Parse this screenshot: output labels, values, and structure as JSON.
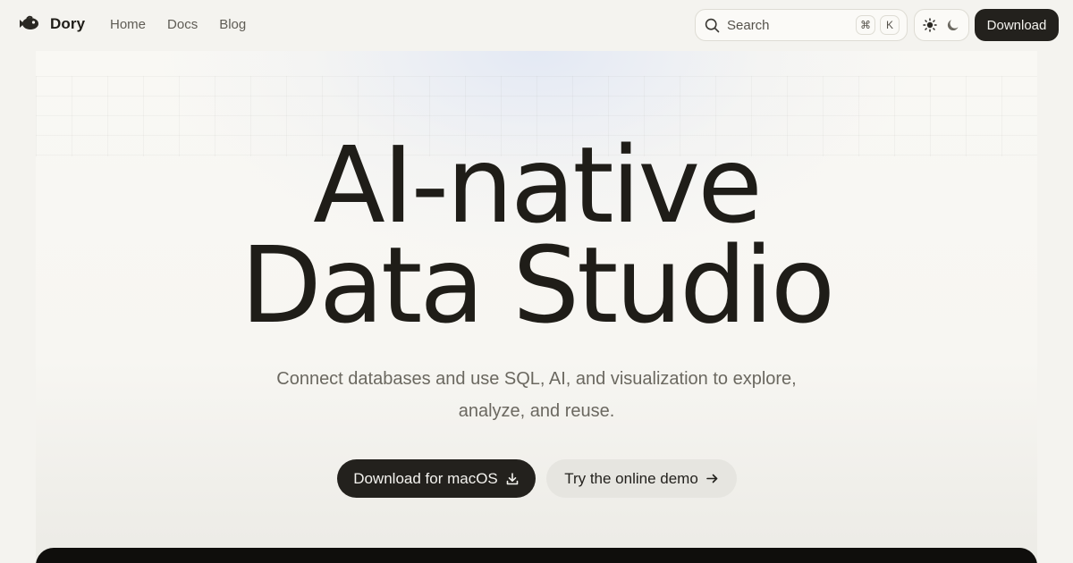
{
  "header": {
    "brand_name": "Dory",
    "nav": [
      {
        "label": "Home"
      },
      {
        "label": "Docs"
      },
      {
        "label": "Blog"
      }
    ],
    "search": {
      "placeholder": "Search",
      "shortcut_keys": [
        "⌘",
        "K"
      ]
    },
    "theme_toggle": {
      "light_icon": "sun-icon",
      "dark_icon": "moon-icon"
    },
    "download_label": "Download"
  },
  "hero": {
    "title_line1": "AI-native",
    "title_line2": "Data Studio",
    "subtitle": "Connect databases and use SQL, AI, and visualization to explore, analyze, and reuse.",
    "primary_cta": "Download for macOS",
    "secondary_cta": "Try the online demo"
  },
  "colors": {
    "background": "#f4f3ef",
    "dark": "#23211d",
    "text_muted": "#6b6860",
    "accent_glow": "#e2e8f4"
  }
}
